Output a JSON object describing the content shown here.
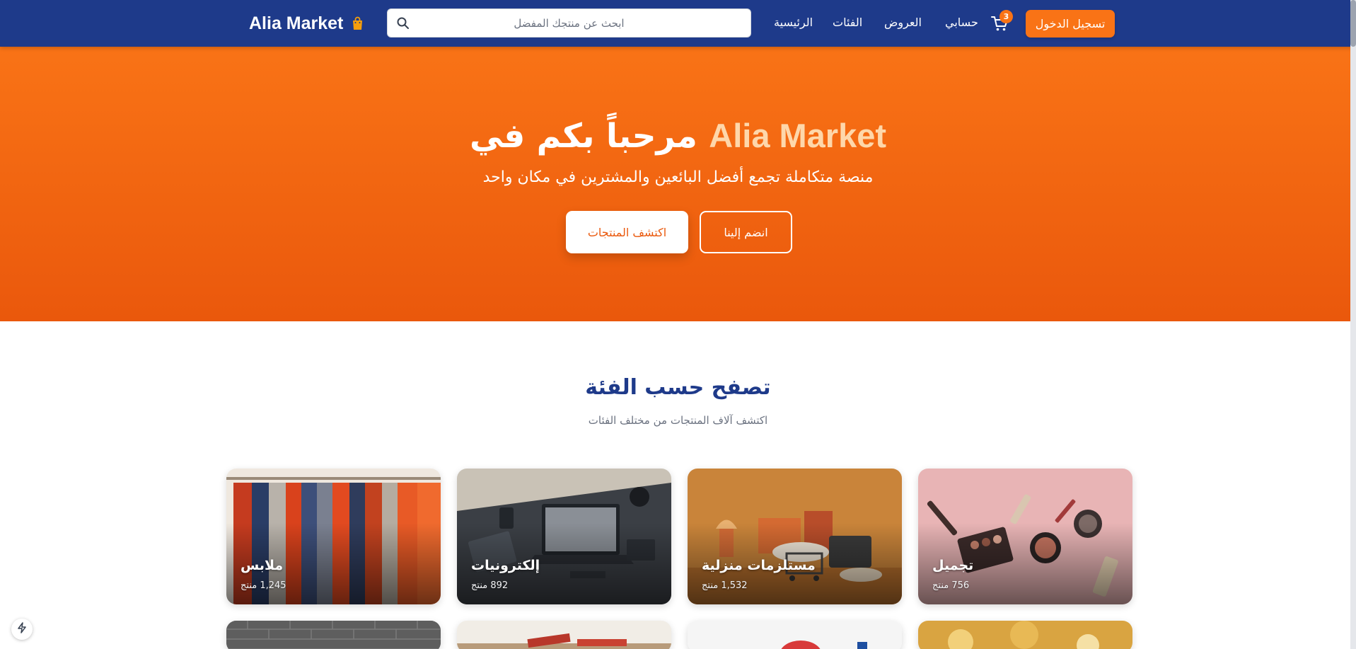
{
  "navbar": {
    "logo_text": "Alia Market",
    "search_placeholder": "ابحث عن منتجك المفضل",
    "links": {
      "home": "الرئيسية",
      "categories": "الفئات",
      "offers": "العروض",
      "account": "حسابي"
    },
    "cart_count": "3",
    "login_label": "تسجيل الدخول"
  },
  "hero": {
    "title_brand": "Alia Market",
    "title_rest": "مرحباً بكم في",
    "subtitle": "منصة متكاملة تجمع أفضل البائعين والمشترين في مكان واحد",
    "explore_label": "اكتشف المنتجات",
    "join_label": "انضم إلينا"
  },
  "categories": {
    "title": "تصفح حسب الفئة",
    "subtitle": "اكتشف آلاف المنتجات من مختلف الفئات",
    "items": [
      {
        "name": "ملابس",
        "count": "1,245 منتج"
      },
      {
        "name": "إلكترونيات",
        "count": "892 منتج"
      },
      {
        "name": "مستلزمات منزلية",
        "count": "1,532 منتج"
      },
      {
        "name": "تجميل",
        "count": "756 منتج"
      }
    ]
  },
  "colors": {
    "navbar": "#1e3a8a",
    "accent": "#f97316",
    "hero_end": "#ea580c",
    "section_title": "#1e3a8a"
  },
  "icons": [
    "bag-icon",
    "search-icon",
    "cart-icon",
    "bolt-icon"
  ]
}
